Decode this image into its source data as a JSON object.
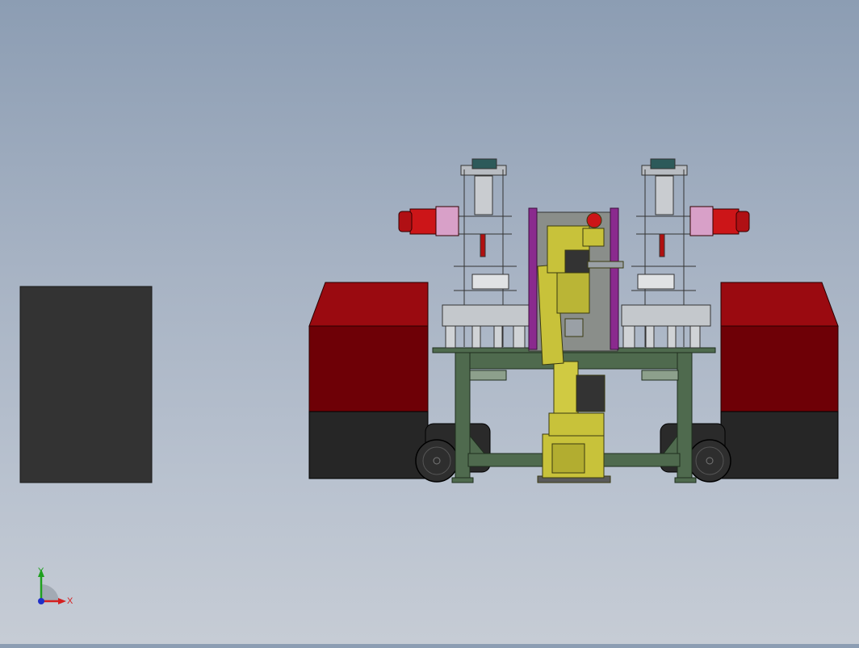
{
  "viewport": {
    "background_top": "#8c9db3",
    "background_bottom": "#c6ccd5"
  },
  "triad": {
    "x_label": "X",
    "y_label": "Y",
    "x_color": "#d42020",
    "y_color": "#1fa01f",
    "z_color": "#2030c8"
  },
  "colors": {
    "conveyor_red": "#7a0008",
    "conveyor_dark": "#222222",
    "robot_yellow": "#c8c23a",
    "frame_green": "#4f6a4e",
    "motor_red": "#cc1518",
    "motor_pink": "#d8a0c8",
    "rail_purple": "#8a2a8e",
    "block_dark": "#333333"
  }
}
